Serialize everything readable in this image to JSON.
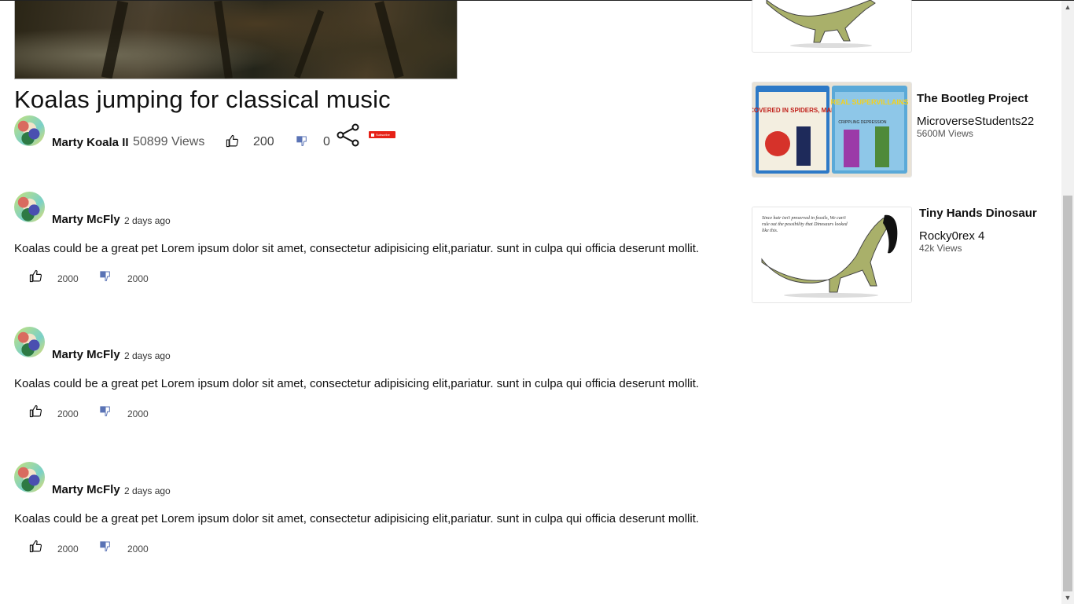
{
  "video": {
    "title": "Koalas jumping for classical music",
    "author": "Marty Koala II",
    "views": "50899 Views",
    "likes": "200",
    "dislikes": "0",
    "subscribe_label": "Subscribe"
  },
  "comments": [
    {
      "author": "Marty McFly",
      "time": "2 days ago",
      "text": "Koalas could be a great pet Lorem ipsum dolor sit amet, consectetur adipisicing elit,pariatur. sunt in culpa qui officia deserunt mollit.",
      "likes": "2000",
      "dislikes": "2000"
    },
    {
      "author": "Marty McFly",
      "time": "2 days ago",
      "text": "Koalas could be a great pet Lorem ipsum dolor sit amet, consectetur adipisicing elit,pariatur. sunt in culpa qui officia deserunt mollit.",
      "likes": "2000",
      "dislikes": "2000"
    },
    {
      "author": "Marty McFly",
      "time": "2 days ago",
      "text": "Koalas could be a great pet Lorem ipsum dolor sit amet, consectetur adipisicing elit,pariatur. sunt in culpa qui officia deserunt mollit.",
      "likes": "2000",
      "dislikes": "2000"
    }
  ],
  "sidebar": {
    "videos": [
      {
        "title": "The Bootleg Project",
        "channel": "MicroverseStudents22",
        "views": "5600M Views",
        "thumb_text": {
          "left_card": "COVERED IN SPIDERS, MAN",
          "right_card": "REAL SUPERVILLAINS",
          "right_sub": "CRIPPLING DEPRESSION"
        }
      },
      {
        "title": "Tiny Hands Dinosaur",
        "channel": "Rocky0rex 4",
        "views": "42k Views",
        "thumb_text": "Since hair isn't preserved in fossils, We can't rule out the possibility that Dinosaurs looked like this."
      }
    ]
  },
  "icons": {
    "like": "thumbs-up-icon",
    "dislike": "thumbs-down-icon",
    "share": "share-icon",
    "scroll_up": "▲",
    "scroll_down": "▼"
  },
  "colors": {
    "subscribe": "#e62117",
    "dislike_blue": "#5a73b5"
  }
}
